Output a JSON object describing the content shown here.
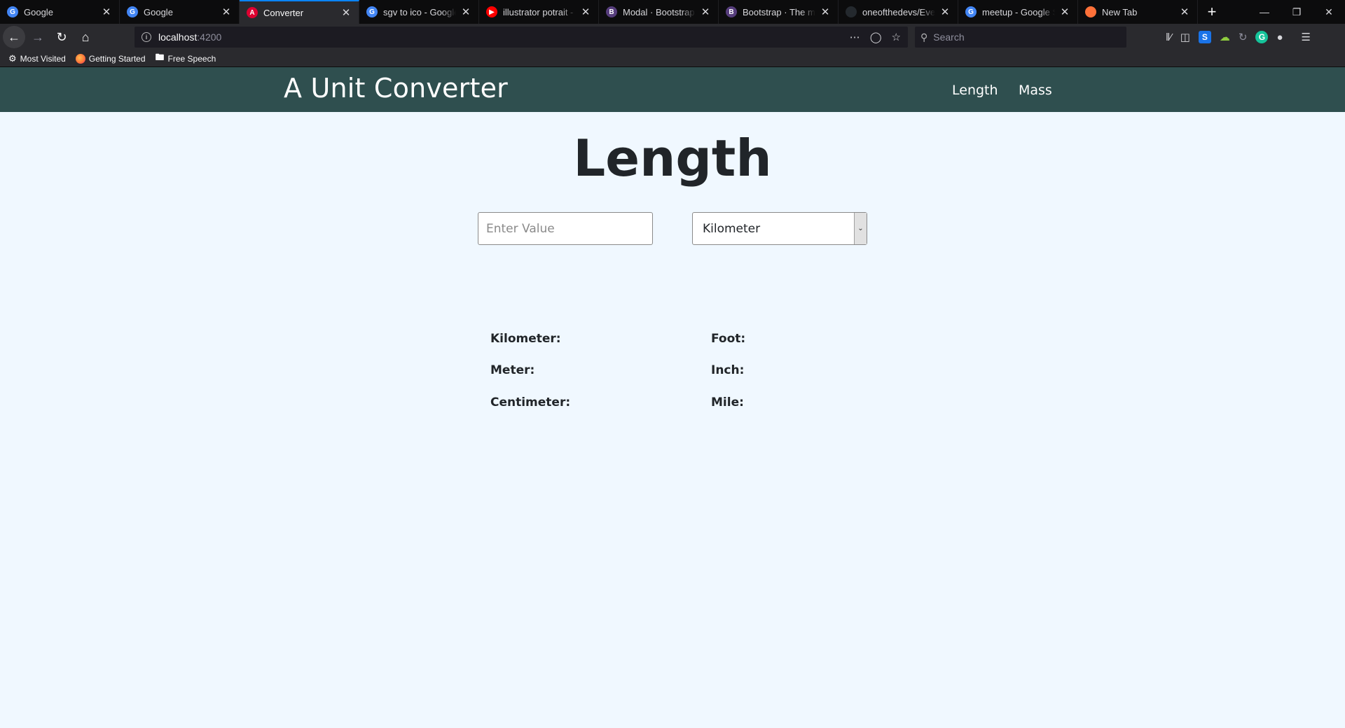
{
  "browser": {
    "tabs": [
      {
        "title": "Google",
        "icon": "google-icon",
        "color": "#4285f4",
        "glyph": "G",
        "active": false
      },
      {
        "title": "Google",
        "icon": "google-icon",
        "color": "#4285f4",
        "glyph": "G",
        "active": false
      },
      {
        "title": "Converter",
        "icon": "angular-icon",
        "color": "#dd0031",
        "glyph": "A",
        "active": true
      },
      {
        "title": "sgv to ico - Google S",
        "icon": "google-icon",
        "color": "#4285f4",
        "glyph": "G",
        "active": false
      },
      {
        "title": "illustrator potrait - Yo",
        "icon": "youtube-icon",
        "color": "#ff0000",
        "glyph": "▶",
        "active": false
      },
      {
        "title": "Modal · Bootstrap",
        "icon": "bootstrap-icon",
        "color": "#563d7c",
        "glyph": "B",
        "active": false
      },
      {
        "title": "Bootstrap · The most",
        "icon": "bootstrap-icon",
        "color": "#563d7c",
        "glyph": "B",
        "active": false
      },
      {
        "title": "oneofthedevs/Eventi",
        "icon": "github-icon",
        "color": "#24292e",
        "glyph": "",
        "active": false
      },
      {
        "title": "meetup - Google Sea",
        "icon": "google-icon",
        "color": "#4285f4",
        "glyph": "G",
        "active": false
      },
      {
        "title": "New Tab",
        "icon": "firefox-icon",
        "color": "#ff7139",
        "glyph": "",
        "active": false
      }
    ],
    "url_host": "localhost",
    "url_port": ":4200",
    "search_placeholder": "Search",
    "bookmarks": [
      {
        "label": "Most Visited",
        "icon": "gear-icon"
      },
      {
        "label": "Getting Started",
        "icon": "firefox-icon"
      },
      {
        "label": "Free Speech",
        "icon": "folder-icon"
      }
    ]
  },
  "app": {
    "brand": "A Unit Converter",
    "nav": {
      "length": "Length",
      "mass": "Mass"
    },
    "title": "Length",
    "input_placeholder": "Enter Value",
    "selected_unit": "Kilometer",
    "results": {
      "kilometer": "Kilometer:",
      "meter": "Meter:",
      "centimeter": "Centimeter:",
      "foot": "Foot:",
      "inch": "Inch:",
      "mile": "Mile:"
    }
  },
  "colors": {
    "navbar_bg": "#2f4f4f",
    "page_bg": "#f0f8ff"
  }
}
